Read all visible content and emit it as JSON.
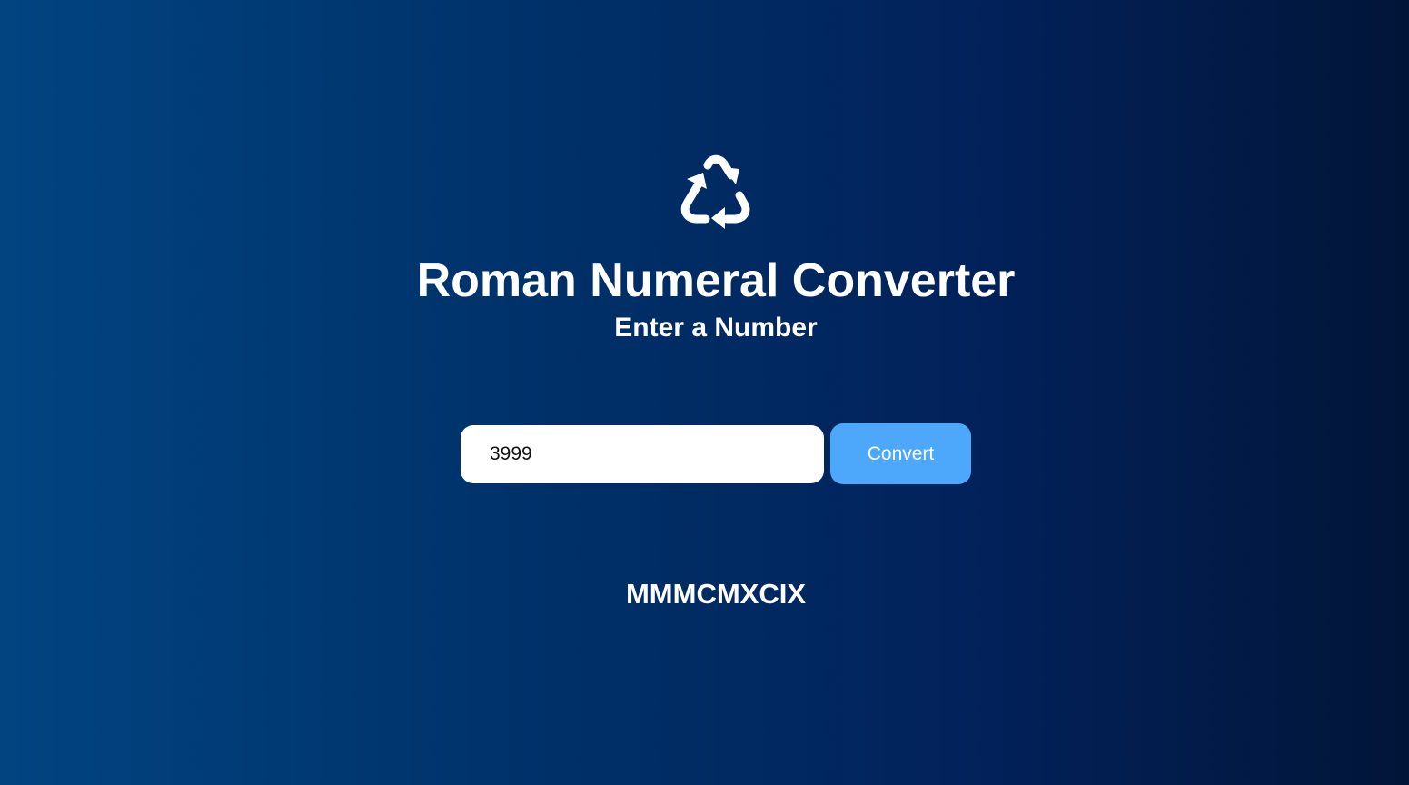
{
  "app": {
    "logo_icon": "recycle-icon",
    "title": "Roman Numeral Converter",
    "subtitle": "Enter a Number"
  },
  "form": {
    "input_value": "3999",
    "button_label": "Convert"
  },
  "result": {
    "output": "MMMCMXCIX"
  },
  "colors": {
    "background_left": "#014481",
    "background_right": "#011538",
    "button": "#4da8fc",
    "text": "#ffffff"
  }
}
